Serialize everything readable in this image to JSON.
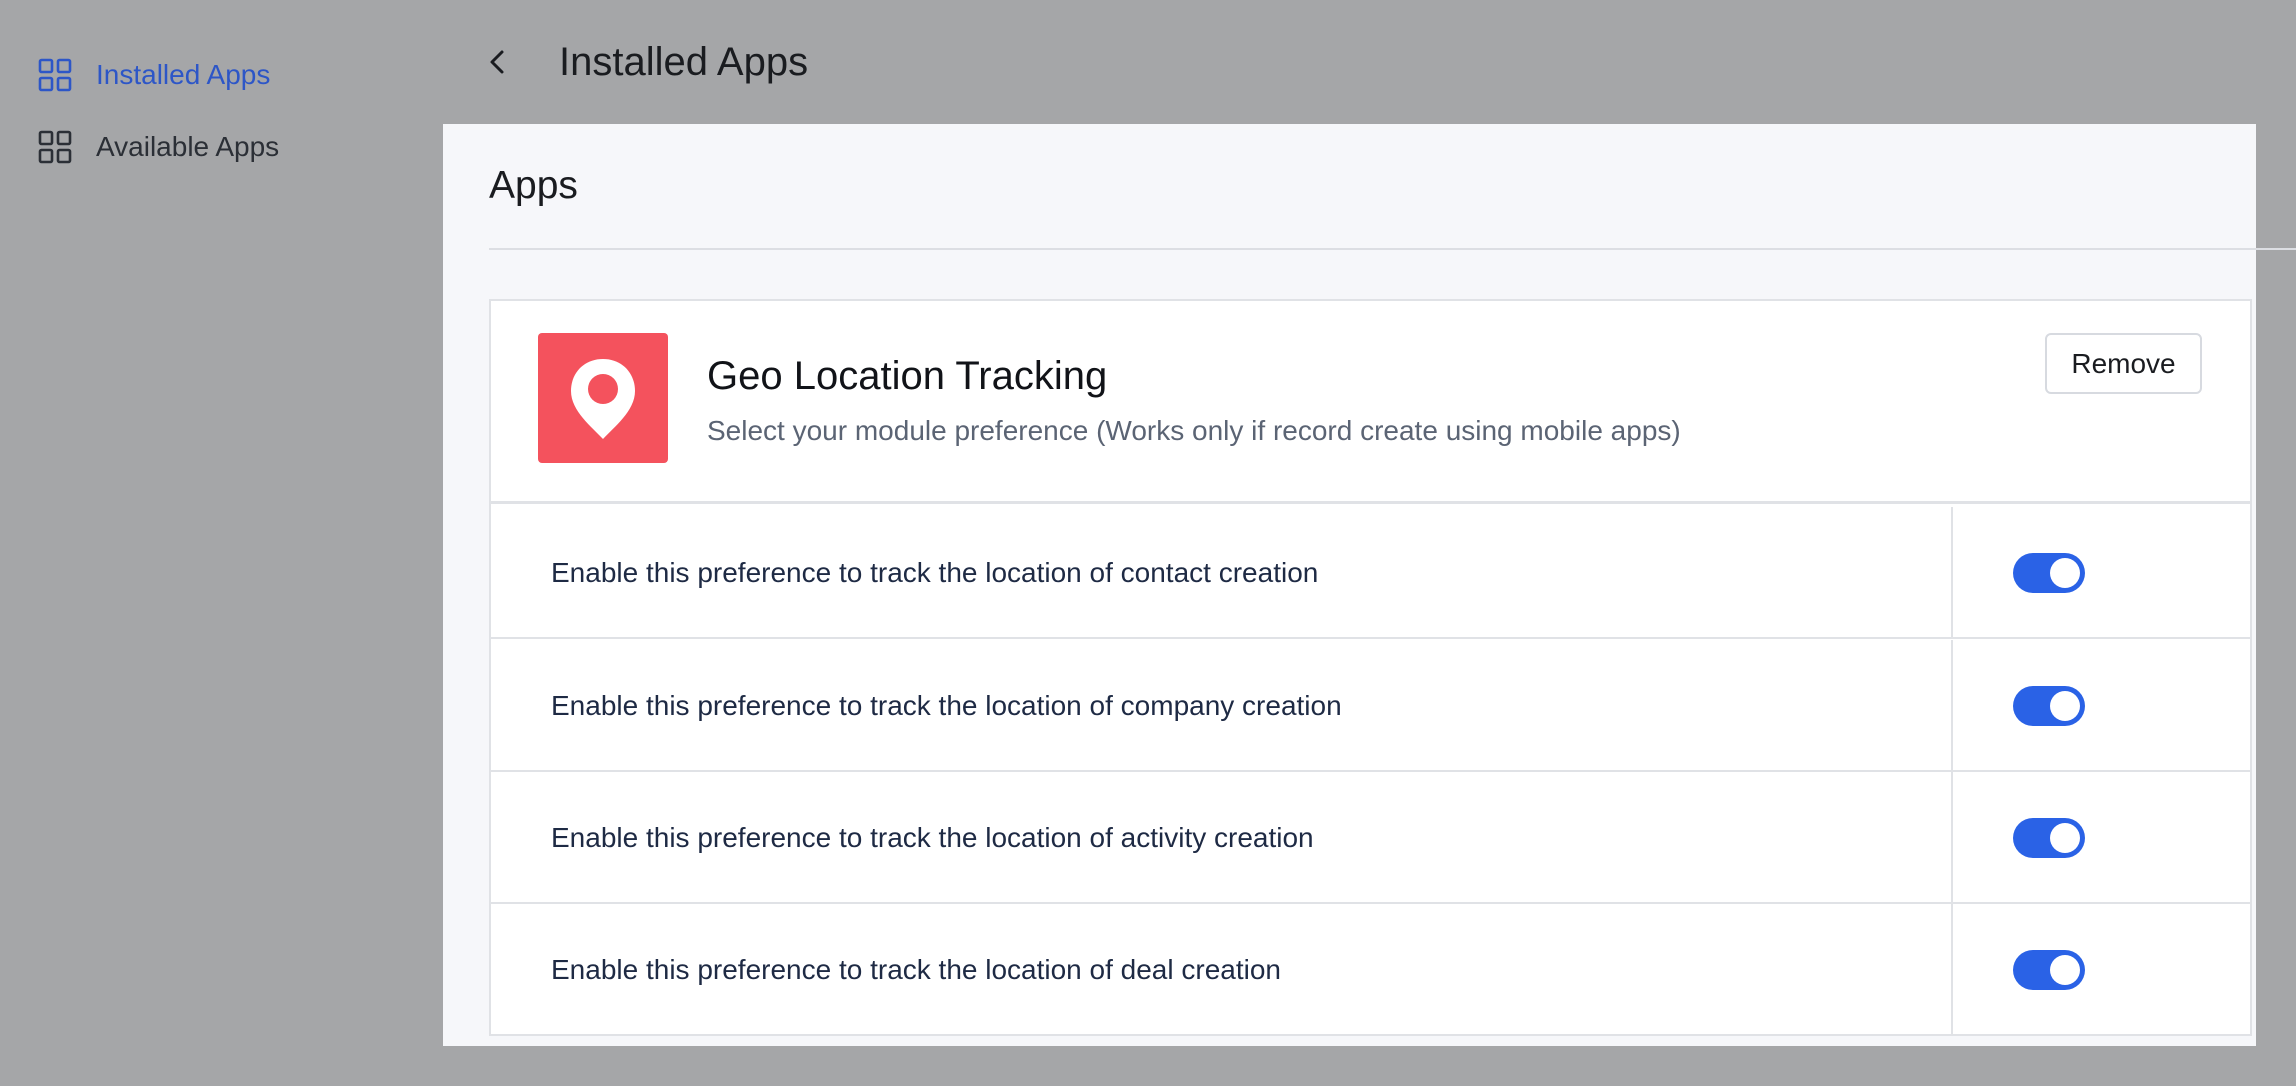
{
  "sidebar": {
    "items": [
      {
        "label": "Installed Apps",
        "icon": "grid-icon",
        "active": true,
        "color": "#2d56c7"
      },
      {
        "label": "Available Apps",
        "icon": "grid-icon",
        "active": false,
        "color": "#2b2f36"
      }
    ]
  },
  "header": {
    "back_icon": "chevron-left-icon",
    "title": "Installed Apps"
  },
  "panel": {
    "title": "Apps"
  },
  "app": {
    "name": "Geo Location Tracking",
    "description": "Select your module preference (Works only if record create using mobile apps)",
    "logo_icon": "location-pin-icon",
    "logo_color": "#f4525d",
    "remove_label": "Remove"
  },
  "preferences": [
    {
      "label": "Enable this preference to track the location of contact creation",
      "enabled": true
    },
    {
      "label": "Enable this preference to track the location of company creation",
      "enabled": true
    },
    {
      "label": "Enable this preference to track the location of activity creation",
      "enabled": true
    },
    {
      "label": "Enable this preference to track the location of deal creation",
      "enabled": true
    }
  ],
  "colors": {
    "accent": "#2a62e6",
    "backdrop": "#a5a6a8"
  }
}
